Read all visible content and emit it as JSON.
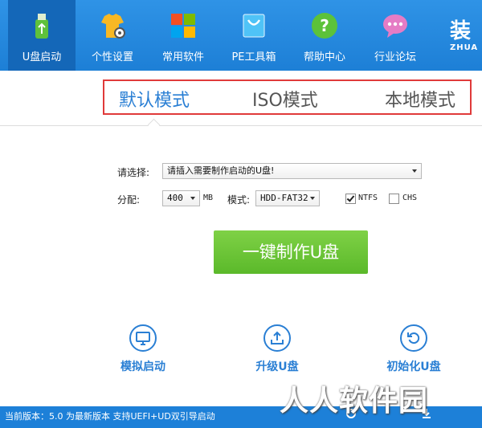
{
  "nav": {
    "items": [
      {
        "label": "U盘启动",
        "icon": "usb-icon"
      },
      {
        "label": "个性设置",
        "icon": "tshirt-gear-icon"
      },
      {
        "label": "常用软件",
        "icon": "windows-icon"
      },
      {
        "label": "PE工具箱",
        "icon": "shopping-bag-icon"
      },
      {
        "label": "帮助中心",
        "icon": "help-icon"
      },
      {
        "label": "行业论坛",
        "icon": "chat-icon"
      }
    ],
    "brand": {
      "big": "装",
      "small": "ZHUA"
    }
  },
  "modes": [
    "默认模式",
    "ISO模式",
    "本地模式"
  ],
  "form": {
    "select_label": "请选择:",
    "select_value": "请插入需要制作启动的U盘!",
    "alloc_label": "分配:",
    "alloc_value": "400",
    "alloc_unit": "MB",
    "mode_label": "模式:",
    "mode_value": "HDD-FAT32",
    "ntfs_label": "NTFS",
    "ntfs_checked": true,
    "chs_label": "CHS",
    "chs_checked": false
  },
  "main_button": "一键制作U盘",
  "tools": [
    {
      "label": "模拟启动",
      "icon": "monitor-icon"
    },
    {
      "label": "升级U盘",
      "icon": "upload-icon"
    },
    {
      "label": "初始化U盘",
      "icon": "reset-icon"
    }
  ],
  "status": {
    "text": "当前版本：5.0 为最新版本 支持UEFI+UD双引导启动",
    "watermark": "人人软件园"
  },
  "colors": {
    "topbar": "#1d7fd6",
    "active_tab": "#2a7fd4",
    "highlight_box": "#e03a3a",
    "main_button": "#63bd30"
  }
}
